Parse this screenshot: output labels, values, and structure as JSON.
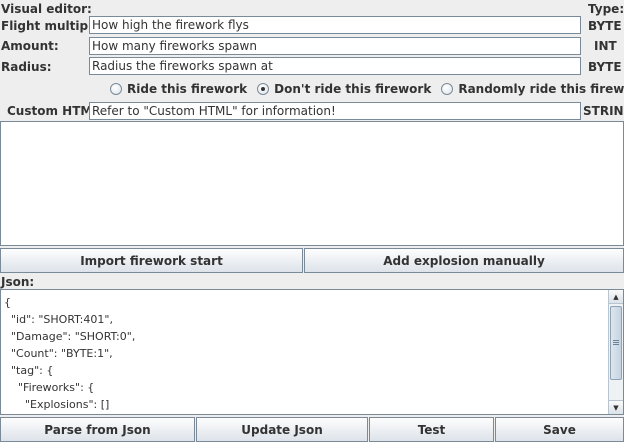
{
  "editor": {
    "visual_label": "Visual editor:",
    "type_label": "Type:"
  },
  "fields": [
    {
      "label": "Flight multiplier:",
      "value": "How high the firework flys",
      "type": "BYTE"
    },
    {
      "label": "Amount:",
      "value": "How many fireworks spawn",
      "type": "INT"
    },
    {
      "label": "Radius:",
      "value": "Radius the fireworks spawn at",
      "type": "BYTE"
    }
  ],
  "ride_options": {
    "items": [
      "Ride this firework",
      "Don't ride this firework",
      "Randomly ride this firework"
    ],
    "selected": "Don't ride this firework"
  },
  "custom_html": {
    "label": "Custom HTML:",
    "value": "Refer to \"Custom HTML\" for information!",
    "type": "STRING"
  },
  "actions": {
    "import_label": "Import firework start",
    "add_explosion_label": "Add explosion manually"
  },
  "json_section": {
    "label": "Json:",
    "lines": [
      "{",
      "  \"id\": \"SHORT:401\",",
      "  \"Damage\": \"SHORT:0\",",
      "  \"Count\": \"BYTE:1\",",
      "  \"tag\": {",
      "    \"Fireworks\": {",
      "      \"Explosions\": []",
      "    }"
    ]
  },
  "bottom_buttons": {
    "parse_label": "Parse from Json",
    "update_label": "Update Json",
    "test_label": "Test",
    "save_label": "Save"
  },
  "icons": {
    "scroll_up": "triangle-up",
    "scroll_down": "triangle-down"
  }
}
